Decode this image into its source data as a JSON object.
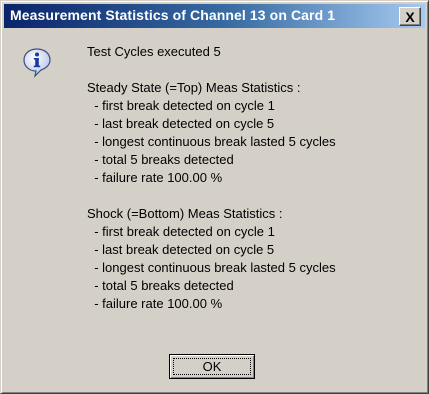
{
  "window": {
    "title": "Measurement Statistics of Channel 13 on Card 1",
    "close_label": "X"
  },
  "message": {
    "lines": [
      "Test Cycles executed 5",
      "",
      "Steady State (=Top) Meas Statistics :",
      "  - first break detected on cycle 1",
      "  - last break detected on cycle 5",
      "  - longest continuous break lasted 5 cycles",
      "  - total 5 breaks detected",
      "  - failure rate 100.00 %",
      "",
      "Shock (=Bottom) Meas Statistics :",
      "  - first break detected on cycle 1",
      "  - last break detected on cycle 5",
      "  - longest continuous break lasted 5 cycles",
      "  - total 5 breaks detected",
      "  - failure rate 100.00 %"
    ]
  },
  "buttons": {
    "ok_label": "OK"
  },
  "icon": {
    "type": "information-icon"
  }
}
